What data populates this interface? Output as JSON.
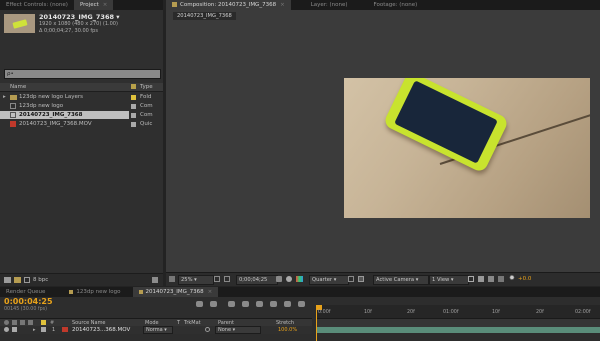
{
  "left_tabs": {
    "effect_controls": "Effect Controls: (none)",
    "project": "Project"
  },
  "comp_tabs": {
    "composition": "Composition: 20140723_IMG_7368",
    "layer": "Layer: (none)",
    "footage": "Footage: (none)"
  },
  "breadcrumb": "20140723_IMG_7368",
  "preview": {
    "name": "20140723_IMG_7368 ▾",
    "line1": "1920 x 1080  (480 x 270) (1.00)",
    "line2": "Δ 0;00;04;27, 30.00 fps"
  },
  "search": {
    "placeholder": "ρ•"
  },
  "project_columns": {
    "name": "Name",
    "type": "Type"
  },
  "project_items": [
    {
      "name": "123dp new logo Layers",
      "type": "Fold",
      "kind": "folder"
    },
    {
      "name": "123dp new logo",
      "type": "Com",
      "kind": "comp"
    },
    {
      "name": "20140723_IMG_7368",
      "type": "Com",
      "kind": "comp",
      "selected": true
    },
    {
      "name": "20140723_IMG_7368.MOV",
      "type": "Quic",
      "kind": "movie"
    }
  ],
  "project_footer": {
    "bpc": "8 bpc"
  },
  "viewer_toolbar": {
    "zoom": "25%",
    "timecode": "0;00;04;25",
    "resolution": "Quarter",
    "camera": "Active Camera",
    "views": "1 View",
    "exposure": "+0.0"
  },
  "timeline_tabs": {
    "render_queue": "Render Queue",
    "logo": "123dp new logo",
    "img": "20140723_IMG_7368"
  },
  "timeline": {
    "timecode": "0:00:04:25",
    "fps": "00145 (30.00 fps)",
    "col_source": "Source Name",
    "col_mode": "Mode",
    "col_t": "T",
    "col_trkmat": "TrkMat",
    "col_parent": "Parent",
    "col_stretch": "Stretch",
    "ruler": [
      "0:00f",
      "10f",
      "20f",
      "01:00f",
      "10f",
      "20f",
      "02:00f"
    ],
    "layer": {
      "num": "1",
      "name": "20140723...368.MOV",
      "mode": "Norma",
      "parent": "None",
      "stretch": "100.0%"
    }
  },
  "colors": {
    "accent_orange": "#e8a21a",
    "label_yellow": "#e0c23c",
    "selection": "#bfbfbf"
  }
}
